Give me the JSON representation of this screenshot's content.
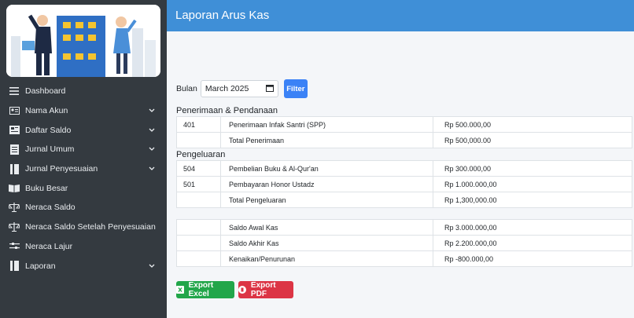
{
  "header": {
    "title": "Laporan Arus Kas"
  },
  "sidebar": {
    "items": [
      {
        "label": "Dashboard",
        "icon": "menu-icon",
        "chevron": false
      },
      {
        "label": "Nama Akun",
        "icon": "id-card-icon",
        "chevron": true
      },
      {
        "label": "Daftar Saldo",
        "icon": "list-card-icon",
        "chevron": true
      },
      {
        "label": "Jurnal Umum",
        "icon": "book-icon",
        "chevron": true
      },
      {
        "label": "Jurnal Penyesuaian",
        "icon": "book-icon",
        "chevron": true
      },
      {
        "label": "Buku Besar",
        "icon": "open-book-icon",
        "chevron": false
      },
      {
        "label": "Neraca Saldo",
        "icon": "scale-icon",
        "chevron": false
      },
      {
        "label": "Neraca Saldo Setelah Penyesuaian",
        "icon": "scale-icon",
        "chevron": false
      },
      {
        "label": "Neraca Lajur",
        "icon": "sliders-icon",
        "chevron": false
      },
      {
        "label": "Laporan",
        "icon": "book-icon",
        "chevron": true
      }
    ]
  },
  "filter": {
    "label": "Bulan",
    "month_value": "March 2025",
    "button_label": "Filter"
  },
  "penerimaan": {
    "title": "Penerimaan & Pendanaan",
    "rows": [
      {
        "code": "401",
        "name": "Penerimaan Infak Santri (SPP)",
        "amount": "Rp 500.000,00"
      }
    ],
    "total": {
      "name": "Total Penerimaan",
      "amount": "Rp 500,000.00"
    }
  },
  "pengeluaran": {
    "title": "Pengeluaran",
    "rows": [
      {
        "code": "504",
        "name": "Pembelian Buku & Al-Qur'an",
        "amount": "Rp 300.000,00"
      },
      {
        "code": "501",
        "name": "Pembayaran Honor Ustadz",
        "amount": "Rp 1.000.000,00"
      }
    ],
    "total": {
      "name": "Total Pengeluaran",
      "amount": "Rp 1,300,000.00"
    }
  },
  "summary": {
    "rows": [
      {
        "name": "Saldo Awal Kas",
        "amount": "Rp 3.000.000,00"
      },
      {
        "name": "Saldo Akhir Kas",
        "amount": "Rp 2.200.000,00"
      },
      {
        "name": "Kenaikan/Penurunan",
        "amount": "Rp -800.000,00"
      }
    ]
  },
  "export": {
    "excel_label": "Export Excel",
    "pdf_label": "Export PDF"
  },
  "colors": {
    "header": "#3f8fd7",
    "sidebar": "#343a40",
    "excel": "#22a64a",
    "pdf": "#dc3545",
    "filter": "#3b82f6"
  }
}
